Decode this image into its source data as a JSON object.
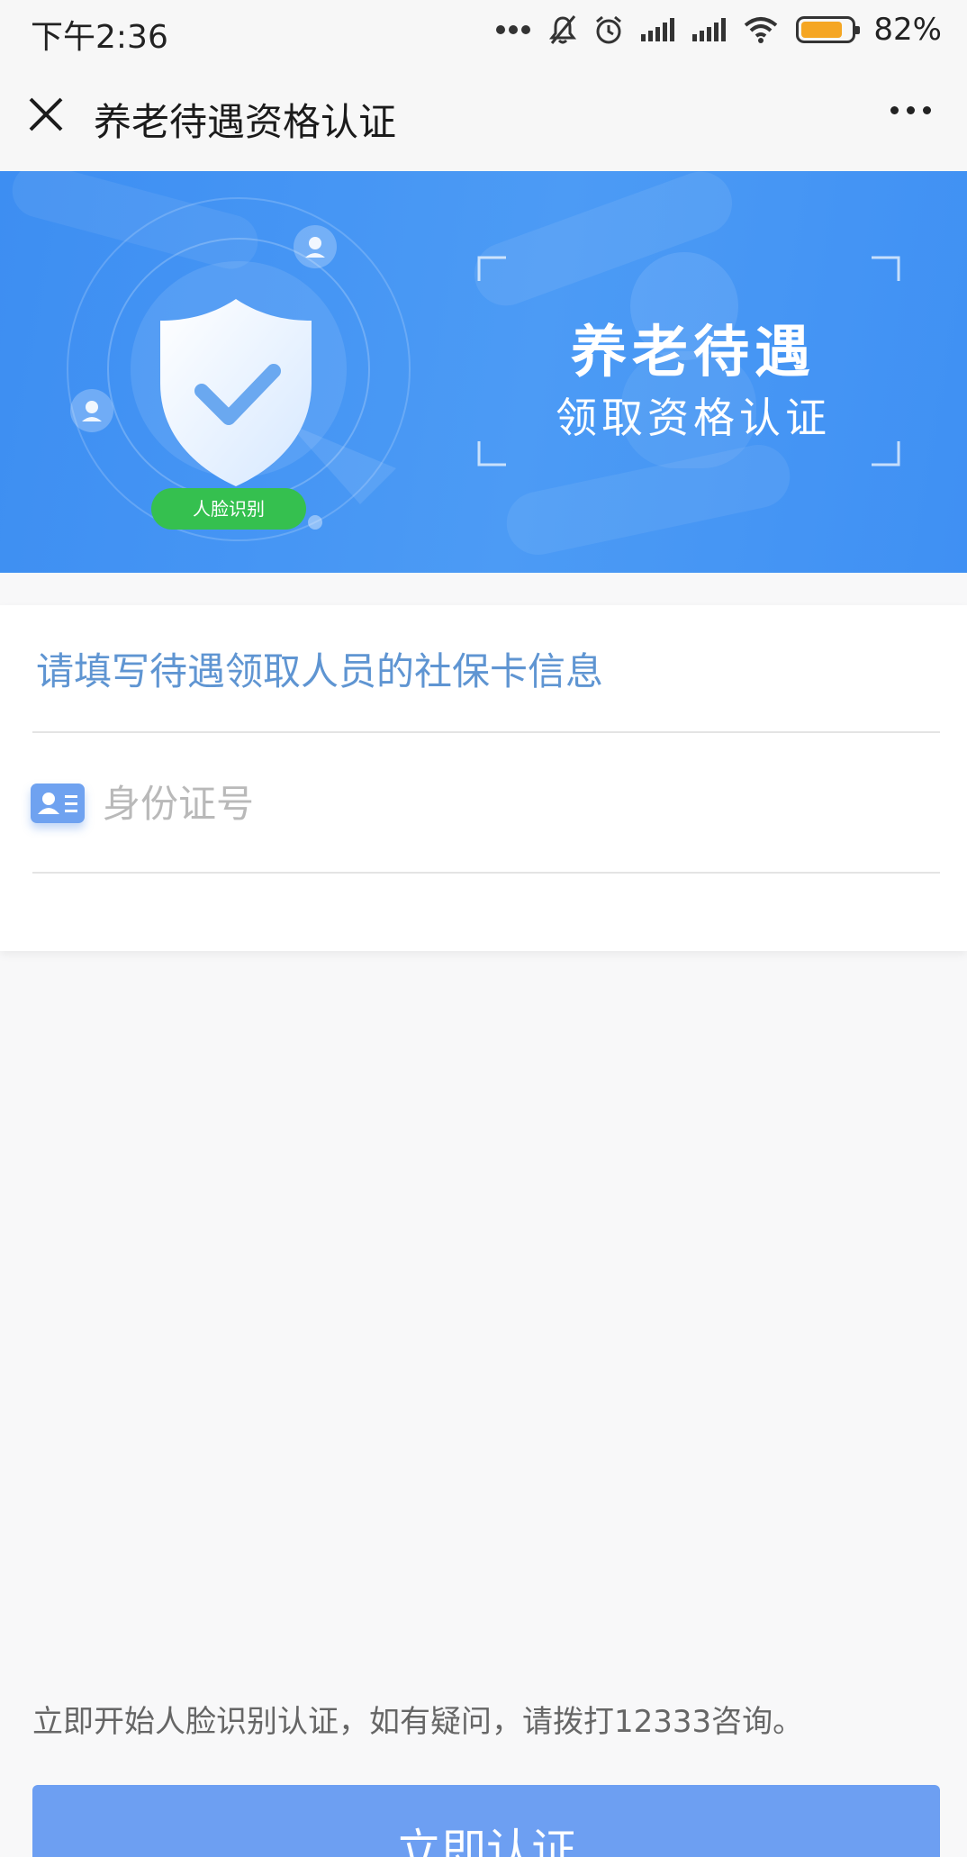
{
  "status_bar": {
    "time": "下午2:36",
    "battery_pct": "82%",
    "battery_level": 0.82,
    "battery_color": "#f5a623",
    "icons": [
      "more-dots-icon",
      "mute-bell-icon",
      "alarm-icon",
      "signal-icon",
      "signal-icon",
      "wifi-icon",
      "battery-icon"
    ]
  },
  "nav": {
    "title": "养老待遇资格认证",
    "close_icon": "close-icon",
    "more_icon": "more-icon"
  },
  "banner": {
    "title": "养老待遇",
    "subtitle": "领取资格认证",
    "badge": "人脸识别",
    "bg_color": "#4096f4",
    "badge_color": "#35c04f"
  },
  "form": {
    "heading": "请填写待遇领取人员的社保卡信息",
    "id_field": {
      "placeholder": "身份证号",
      "value": "",
      "icon": "id-card-icon"
    }
  },
  "footer": {
    "note": "立即开始人脸识别认证，如有疑问，请拨打12333咨询。",
    "button_label": "立即认证",
    "button_color": "#6d9ff2"
  }
}
